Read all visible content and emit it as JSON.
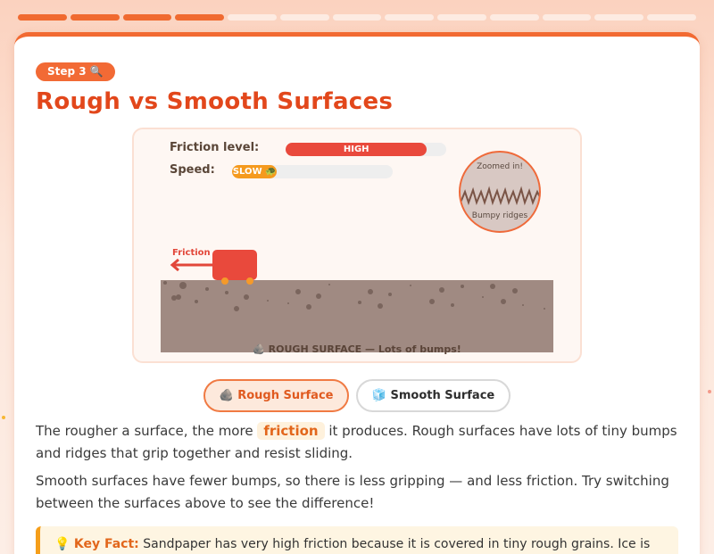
{
  "progress": {
    "total_steps": 13,
    "completed_steps": 4
  },
  "badge": "Step 3 🔍",
  "title": "Rough vs Smooth Surfaces",
  "sim": {
    "friction_label": "Friction level:",
    "friction_value": "HIGH",
    "friction_fraction": 0.88,
    "speed_label": "Speed:",
    "speed_value": "SLOW 🐢",
    "speed_fraction": 0.28,
    "zoom_title": "Zoomed in!",
    "zoom_caption": "Bumpy ridges",
    "friction_arrow_label": "Friction",
    "surface_caption": "🪨 ROUGH SURFACE — Lots of bumps!"
  },
  "toggles": {
    "rough": "🪨 Rough Surface",
    "smooth": "🧊 Smooth Surface"
  },
  "para1": {
    "before": "The rougher a surface, the more ",
    "keyword": "friction",
    "after": " it produces. Rough surfaces have lots of tiny bumps and ridges that grip together and resist sliding."
  },
  "para2": "Smooth surfaces have fewer bumps, so there is less gripping — and less friction. Try switching between the surfaces above to see the difference!",
  "fact": {
    "icon": "💡",
    "label": "Key Fact:",
    "text": " Sandpaper has very high friction because it is covered in tiny rough grains. Ice is smooth and slippery because it has very low friction."
  },
  "colors": {
    "accent": "#f26a32",
    "title": "#e2471b",
    "friction_high": "#e9493c",
    "speed_slow": "#f59a1e",
    "ground": "#a08a82"
  }
}
